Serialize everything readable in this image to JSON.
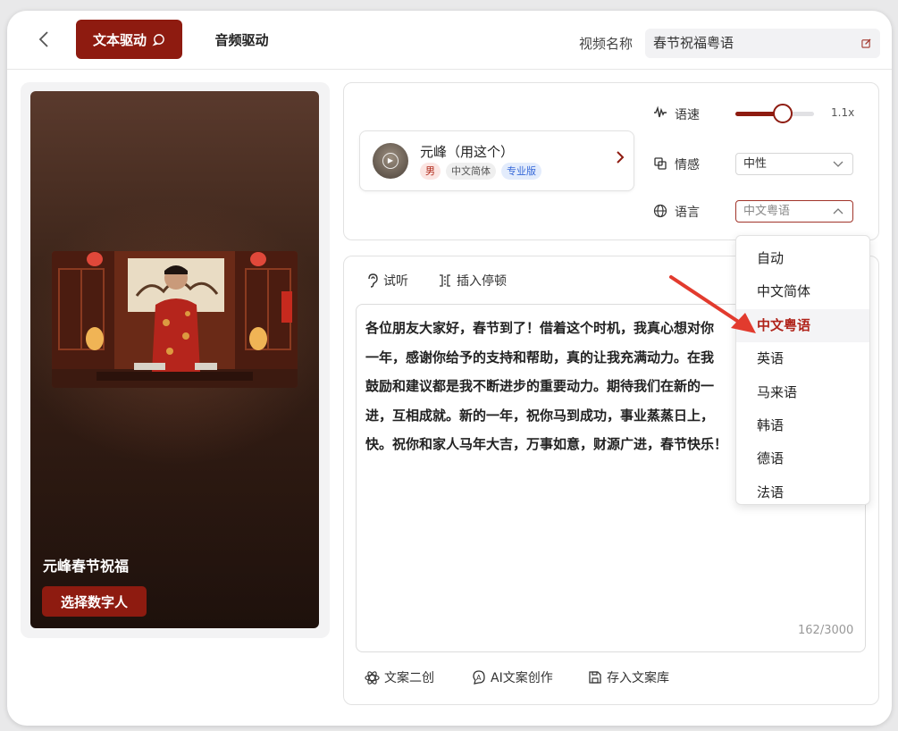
{
  "header": {
    "tab_text_drive": "文本驱动",
    "tab_audio_drive": "音频驱动",
    "video_name_label": "视频名称",
    "video_name_value": "春节祝福粤语"
  },
  "preview": {
    "avatar_name": "元峰春节祝福",
    "choose_button": "选择数字人"
  },
  "voice": {
    "name": "元峰（用这个）",
    "tags": [
      "男",
      "中文简体",
      "专业版"
    ]
  },
  "settings": {
    "speed_label": "语速",
    "speed_value": "1.1x",
    "speed_fraction": 0.6,
    "emotion_label": "情感",
    "emotion_value": "中性",
    "language_label": "语言",
    "language_value": "中文粤语"
  },
  "language_dropdown": {
    "options": [
      "自动",
      "中文简体",
      "中文粤语",
      "英语",
      "马来语",
      "韩语",
      "德语",
      "法语"
    ],
    "selected": "中文粤语"
  },
  "editor": {
    "listen_label": "试听",
    "insert_pause_label": "插入停顿",
    "lines": [
      "各位朋友大家好，春节到了！借着这个时机，我真心想对你",
      "一年，感谢你给予的支持和帮助，真的让我充满动力。在我",
      "鼓励和建议都是我不断进步的重要动力。期待我们在新的一",
      "进，互相成就。新的一年，祝你马到成功，事业蒸蒸日上，",
      "快。祝你和家人马年大吉，万事如意，财源广进，春节快乐！"
    ],
    "counter": "162/3000",
    "rewrite_label": "文案二创",
    "ai_create_label": "AI文案创作",
    "save_library_label": "存入文案库"
  },
  "colors": {
    "brand": "#8e1b10",
    "selected_text": "#b0231a",
    "arrow": "#e23b2e"
  }
}
